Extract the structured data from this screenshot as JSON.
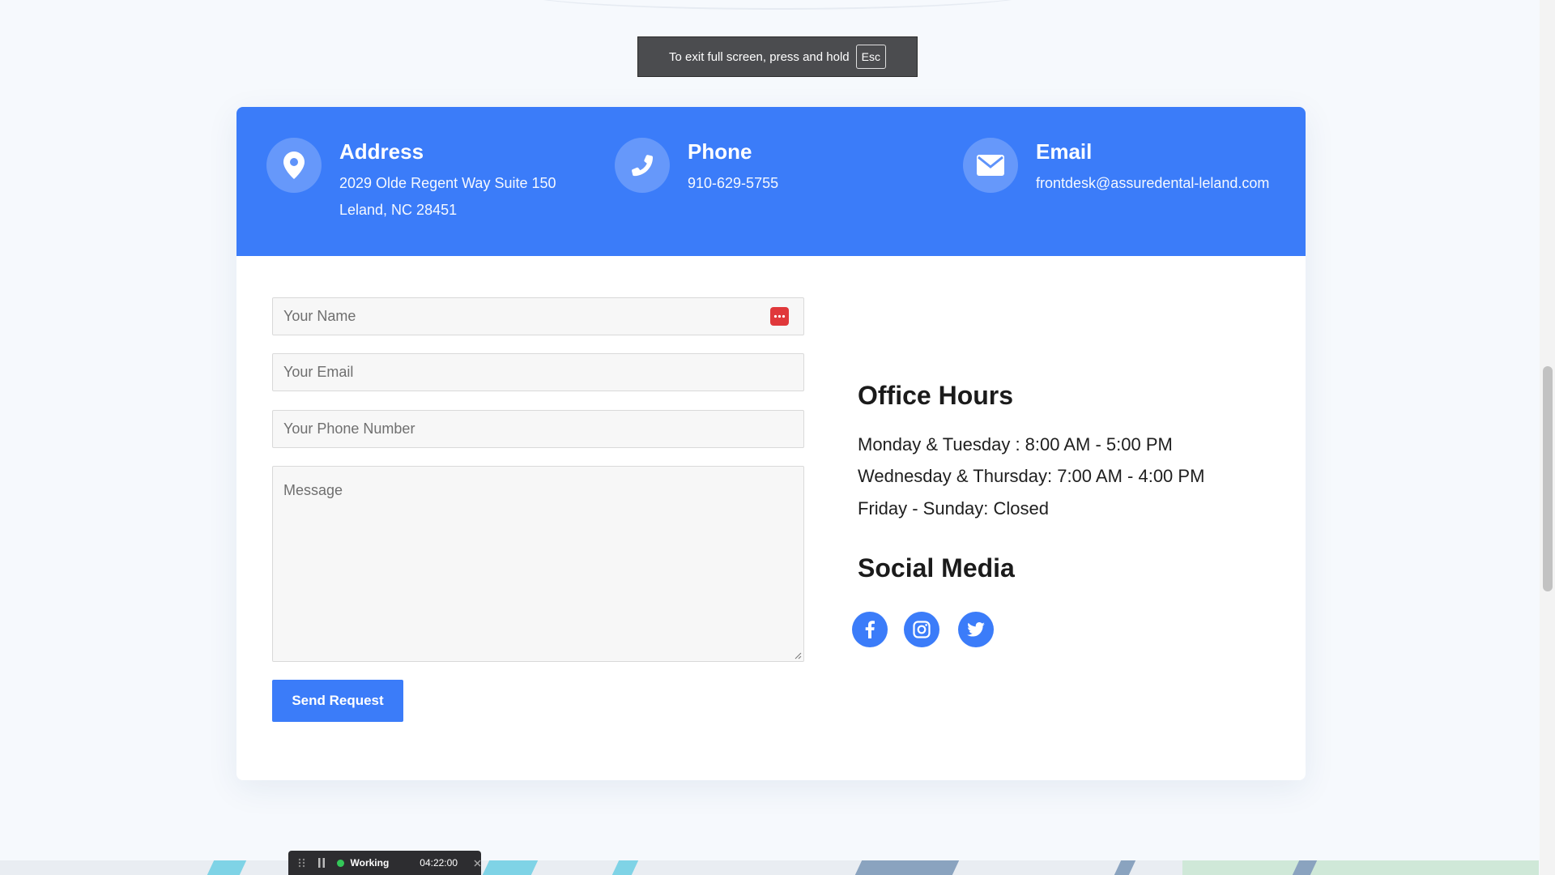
{
  "fullscreen_notice": {
    "text": "To exit full screen, press and hold",
    "key": "Esc"
  },
  "contact_info": {
    "address": {
      "title": "Address",
      "line1": "2029 Olde Regent Way Suite 150",
      "line2": "Leland, NC 28451",
      "icon": "map-pin-icon"
    },
    "phone": {
      "title": "Phone",
      "number": "910-629-5755",
      "icon": "phone-icon"
    },
    "email": {
      "title": "Email",
      "address": "frontdesk@assuredental-leland.com",
      "icon": "envelope-icon"
    }
  },
  "form": {
    "name_placeholder": "Your Name",
    "email_placeholder": "Your Email",
    "phone_placeholder": "Your Phone Number",
    "message_placeholder": "Message",
    "submit_label": "Send Request"
  },
  "office_hours": {
    "title": "Office Hours",
    "lines": [
      "Monday & Tuesday : 8:00 AM - 5:00 PM",
      "Wednesday & Thursday: 7:00 AM - 4:00 PM",
      "Friday - Sunday: Closed"
    ]
  },
  "social": {
    "title": "Social Media",
    "links": [
      "facebook-icon",
      "instagram-icon",
      "twitter-icon"
    ]
  },
  "recorder": {
    "status": "Working",
    "time": "04:22:00"
  },
  "colors": {
    "accent": "#3b7cf9",
    "background": "#f6f9fd",
    "password_manager_icon": "#e0383b"
  }
}
